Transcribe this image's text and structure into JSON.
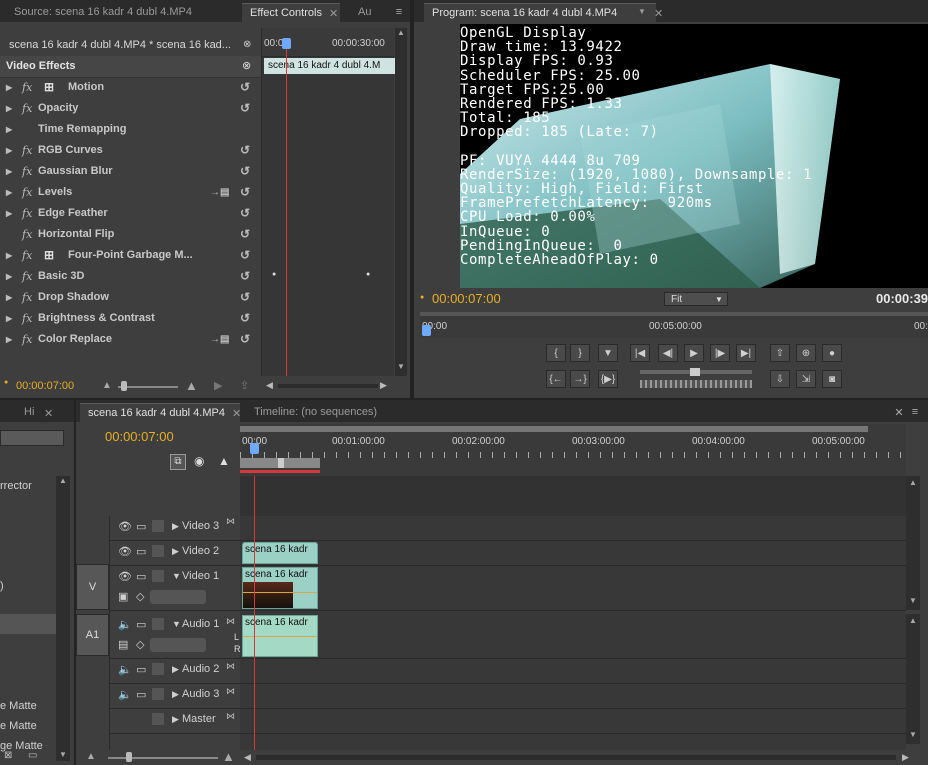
{
  "source_panel": {
    "tabs": [
      "Source: scena 16 kadr 4 dubl 4.MP4",
      "Effect Controls",
      "Au"
    ],
    "clip_path": "scena 16 kadr 4 dubl 4.MP4 * scena 16 kad...",
    "ruler_start": "00:00",
    "ruler_end": "00:00:30:00",
    "clip_label": "scena 16 kadr 4 dubl 4.M",
    "header": "Video Effects",
    "effects": [
      {
        "name": "Motion",
        "has_icon": true,
        "expandable": true,
        "fx": true,
        "reset": true
      },
      {
        "name": "Opacity",
        "expandable": true,
        "fx": true,
        "reset": true
      },
      {
        "name": "Time Remapping",
        "expandable": true,
        "fx": false,
        "reset": false
      },
      {
        "name": "RGB Curves",
        "expandable": true,
        "fx": true,
        "reset": true
      },
      {
        "name": "Gaussian Blur",
        "expandable": true,
        "fx": true,
        "reset": true
      },
      {
        "name": "Levels",
        "expandable": true,
        "fx": true,
        "reset": true,
        "settings": true
      },
      {
        "name": "Edge Feather",
        "expandable": true,
        "fx": true,
        "reset": true
      },
      {
        "name": "Horizontal Flip",
        "expandable": false,
        "fx": true,
        "reset": true
      },
      {
        "name": "Four-Point Garbage M...",
        "has_icon": true,
        "expandable": true,
        "fx": true,
        "reset": true
      },
      {
        "name": "Basic 3D",
        "expandable": true,
        "fx": true,
        "reset": true
      },
      {
        "name": "Drop Shadow",
        "expandable": true,
        "fx": true,
        "reset": true
      },
      {
        "name": "Brightness & Contrast",
        "expandable": true,
        "fx": true,
        "reset": true
      },
      {
        "name": "Color Replace",
        "expandable": true,
        "fx": true,
        "reset": true,
        "settings": true
      }
    ],
    "timecode": "00:00:07:00"
  },
  "program_panel": {
    "tab": "Program: scena 16 kadr 4 dubl 4.MP4",
    "overlay_lines": [
      "OpenGL Display",
      "Draw time: 13.9422",
      "Display FPS: 0.93",
      "Scheduler FPS: 25.00",
      "Target FPS:25.00",
      "Rendered FPS: 1.33",
      "Total: 185",
      "Dropped: 185 (Late: 7)",
      "",
      "PF: VUYA 4444 8u 709",
      "RenderSize: (1920, 1080), Downsample: 1",
      "Quality: High, Field: First",
      "FramePrefetchLatency:  920ms",
      "CPU Load: 0.00%",
      "InQueue: 0",
      "PendingInQueue:  0",
      "CompleteAheadOfPlay: 0"
    ],
    "timecode": "00:00:07:00",
    "fit": "Fit",
    "duration": "00:00:39",
    "ruler": [
      "00:00",
      "00:05:00:00",
      "00:1"
    ]
  },
  "left_panel": {
    "tab": "Hi",
    "items": [
      "rrector",
      ")",
      "e Matte",
      "e Matte",
      "ge Matte"
    ]
  },
  "timeline": {
    "tabs": [
      "scena 16 kadr 4 dubl 4.MP4",
      "Timeline: (no sequences)"
    ],
    "timecode": "00:00:07:00",
    "ruler": [
      "00:00",
      "00:01:00:00",
      "00:02:00:00",
      "00:03:00:00",
      "00:04:00:00",
      "00:05:00:00"
    ],
    "tracks": {
      "v3": "Video 3",
      "v2": "Video 2",
      "v1": "Video 1",
      "a1": "Audio 1",
      "a2": "Audio 2",
      "a3": "Audio 3",
      "master": "Master"
    },
    "v_label": "V",
    "a_label": "A1",
    "clip_label": "scena 16 kadr",
    "lr": [
      "L",
      "R"
    ]
  }
}
